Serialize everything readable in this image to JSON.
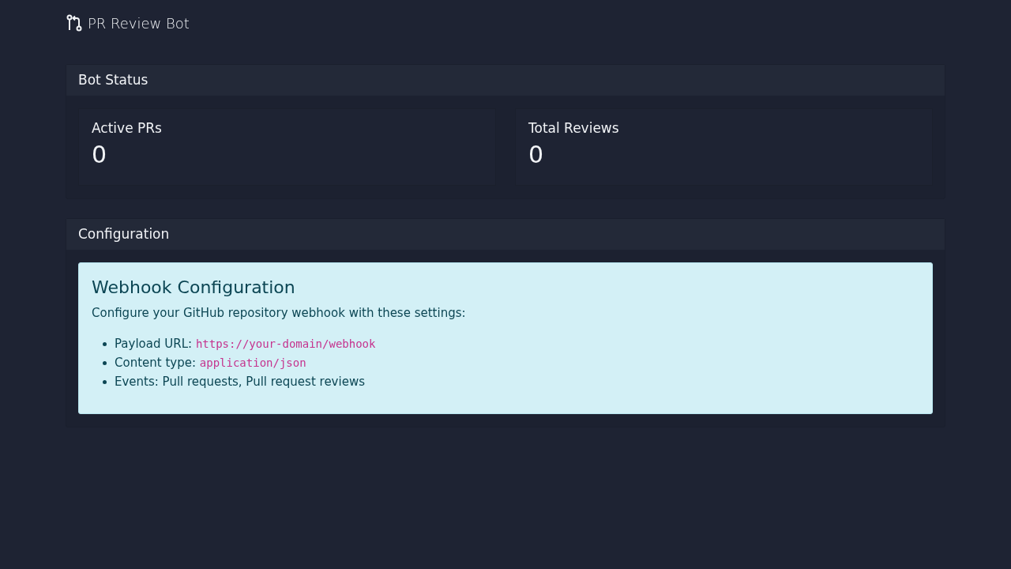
{
  "app": {
    "title": "PR Review Bot"
  },
  "status_panel": {
    "title": "Bot Status",
    "stats": [
      {
        "label": "Active PRs",
        "value": "0"
      },
      {
        "label": "Total Reviews",
        "value": "0"
      }
    ]
  },
  "config_panel": {
    "title": "Configuration",
    "info": {
      "heading": "Webhook Configuration",
      "text": "Configure your GitHub repository webhook with these settings:",
      "items": [
        {
          "label": "Payload URL:",
          "value": "https://your-domain/webhook"
        },
        {
          "label": "Content type:",
          "value": "application/json"
        },
        {
          "label": "Events: Pull requests, Pull request reviews"
        }
      ]
    }
  }
}
